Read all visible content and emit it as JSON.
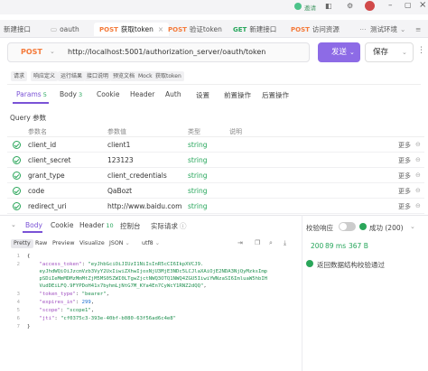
{
  "topbar": {
    "user_label": "邀请"
  },
  "tabs": [
    {
      "label": "新建接口"
    },
    {
      "label": "oauth"
    },
    {
      "method": "POST",
      "label": "获取token"
    },
    {
      "method": "POST",
      "label": "验证token"
    },
    {
      "method": "GET",
      "label": "新建接口"
    },
    {
      "method": "POST",
      "label": "访问资源"
    }
  ],
  "env": {
    "label": "测试环境"
  },
  "request": {
    "method": "POST",
    "url": "http://localhost:5001/authorization_server/oauth/token",
    "send_label": "发送",
    "save_label": "保存"
  },
  "chips": [
    "请求",
    "响应定义",
    "运行结果",
    "接口说明",
    "预览文档",
    "Mock",
    "获取token"
  ],
  "req_tabs": [
    {
      "label": "Params",
      "count": "5"
    },
    {
      "label": "Body",
      "count": "3"
    },
    {
      "label": "Cookie"
    },
    {
      "label": "Header"
    },
    {
      "label": "Auth"
    },
    {
      "label": "设置"
    },
    {
      "label": "前置操作"
    },
    {
      "label": "后置操作"
    }
  ],
  "query_section": "Query 参数",
  "params_headers": {
    "name": "参数名",
    "value": "参数值",
    "type": "类型",
    "desc": "说明"
  },
  "params": [
    {
      "name": "client_id",
      "value": "client1",
      "type": "string"
    },
    {
      "name": "client_secret",
      "value": "123123",
      "type": "string"
    },
    {
      "name": "grant_type",
      "value": "client_credentials",
      "type": "string"
    },
    {
      "name": "code",
      "value": "QaBozt",
      "type": "string"
    },
    {
      "name": "redirect_uri",
      "value": "http://www.baidu.com",
      "type": "string"
    }
  ],
  "row_more": "更多",
  "resp_tabs": [
    {
      "label": "Body"
    },
    {
      "label": "Cookie"
    },
    {
      "label": "Header",
      "count": "10"
    },
    {
      "label": "控制台"
    },
    {
      "label": "实际请求"
    }
  ],
  "view_tabs": [
    "Pretty",
    "Raw",
    "Preview",
    "Visualize",
    "JSON",
    "utf8"
  ],
  "right_panel": {
    "check_label": "校验响应",
    "success_label": "成功 (200)",
    "status": "200",
    "time": "89 ms",
    "size": "367 B",
    "result": "返回数据结构校验通过"
  },
  "response_json": [
    "{",
    "    \"access_token\": \"eyJhbGciOiJIUzI1NiIsInR5cCI6IkpXVCJ9.",
    "    eyJhdWQiOiJzcmVzb3VyY2UxIiwiZXhwIjoxNjU3MjE3NDc5LCJlaXAiOjE2NDA3NjQyMzksImp",
    "    pSDiIeMmMDMzMmMtZjM5MS05ZWI0LTgwZjctNWQ3OTQ1NWQ4ZGU5IiwiYWNzaSI6ImluaW5hbIH",
    "    VudDEiLFQ.9FYPDoH41x7byhmLjNtG7M_KYa4En7CyWcY1RNZ2dQQ\",",
    "    \"token_type\": \"bearer\",",
    "    \"expires_in\": 299,",
    "    \"scope\": \"scope1\",",
    "    \"jti\": \"cf0375c3-393e-40bf-b080-63f56ad6c4e8\"",
    "}"
  ],
  "colors": {
    "accent": "#8d6be6",
    "success": "#2aa65a",
    "post": "#f47a3a"
  }
}
